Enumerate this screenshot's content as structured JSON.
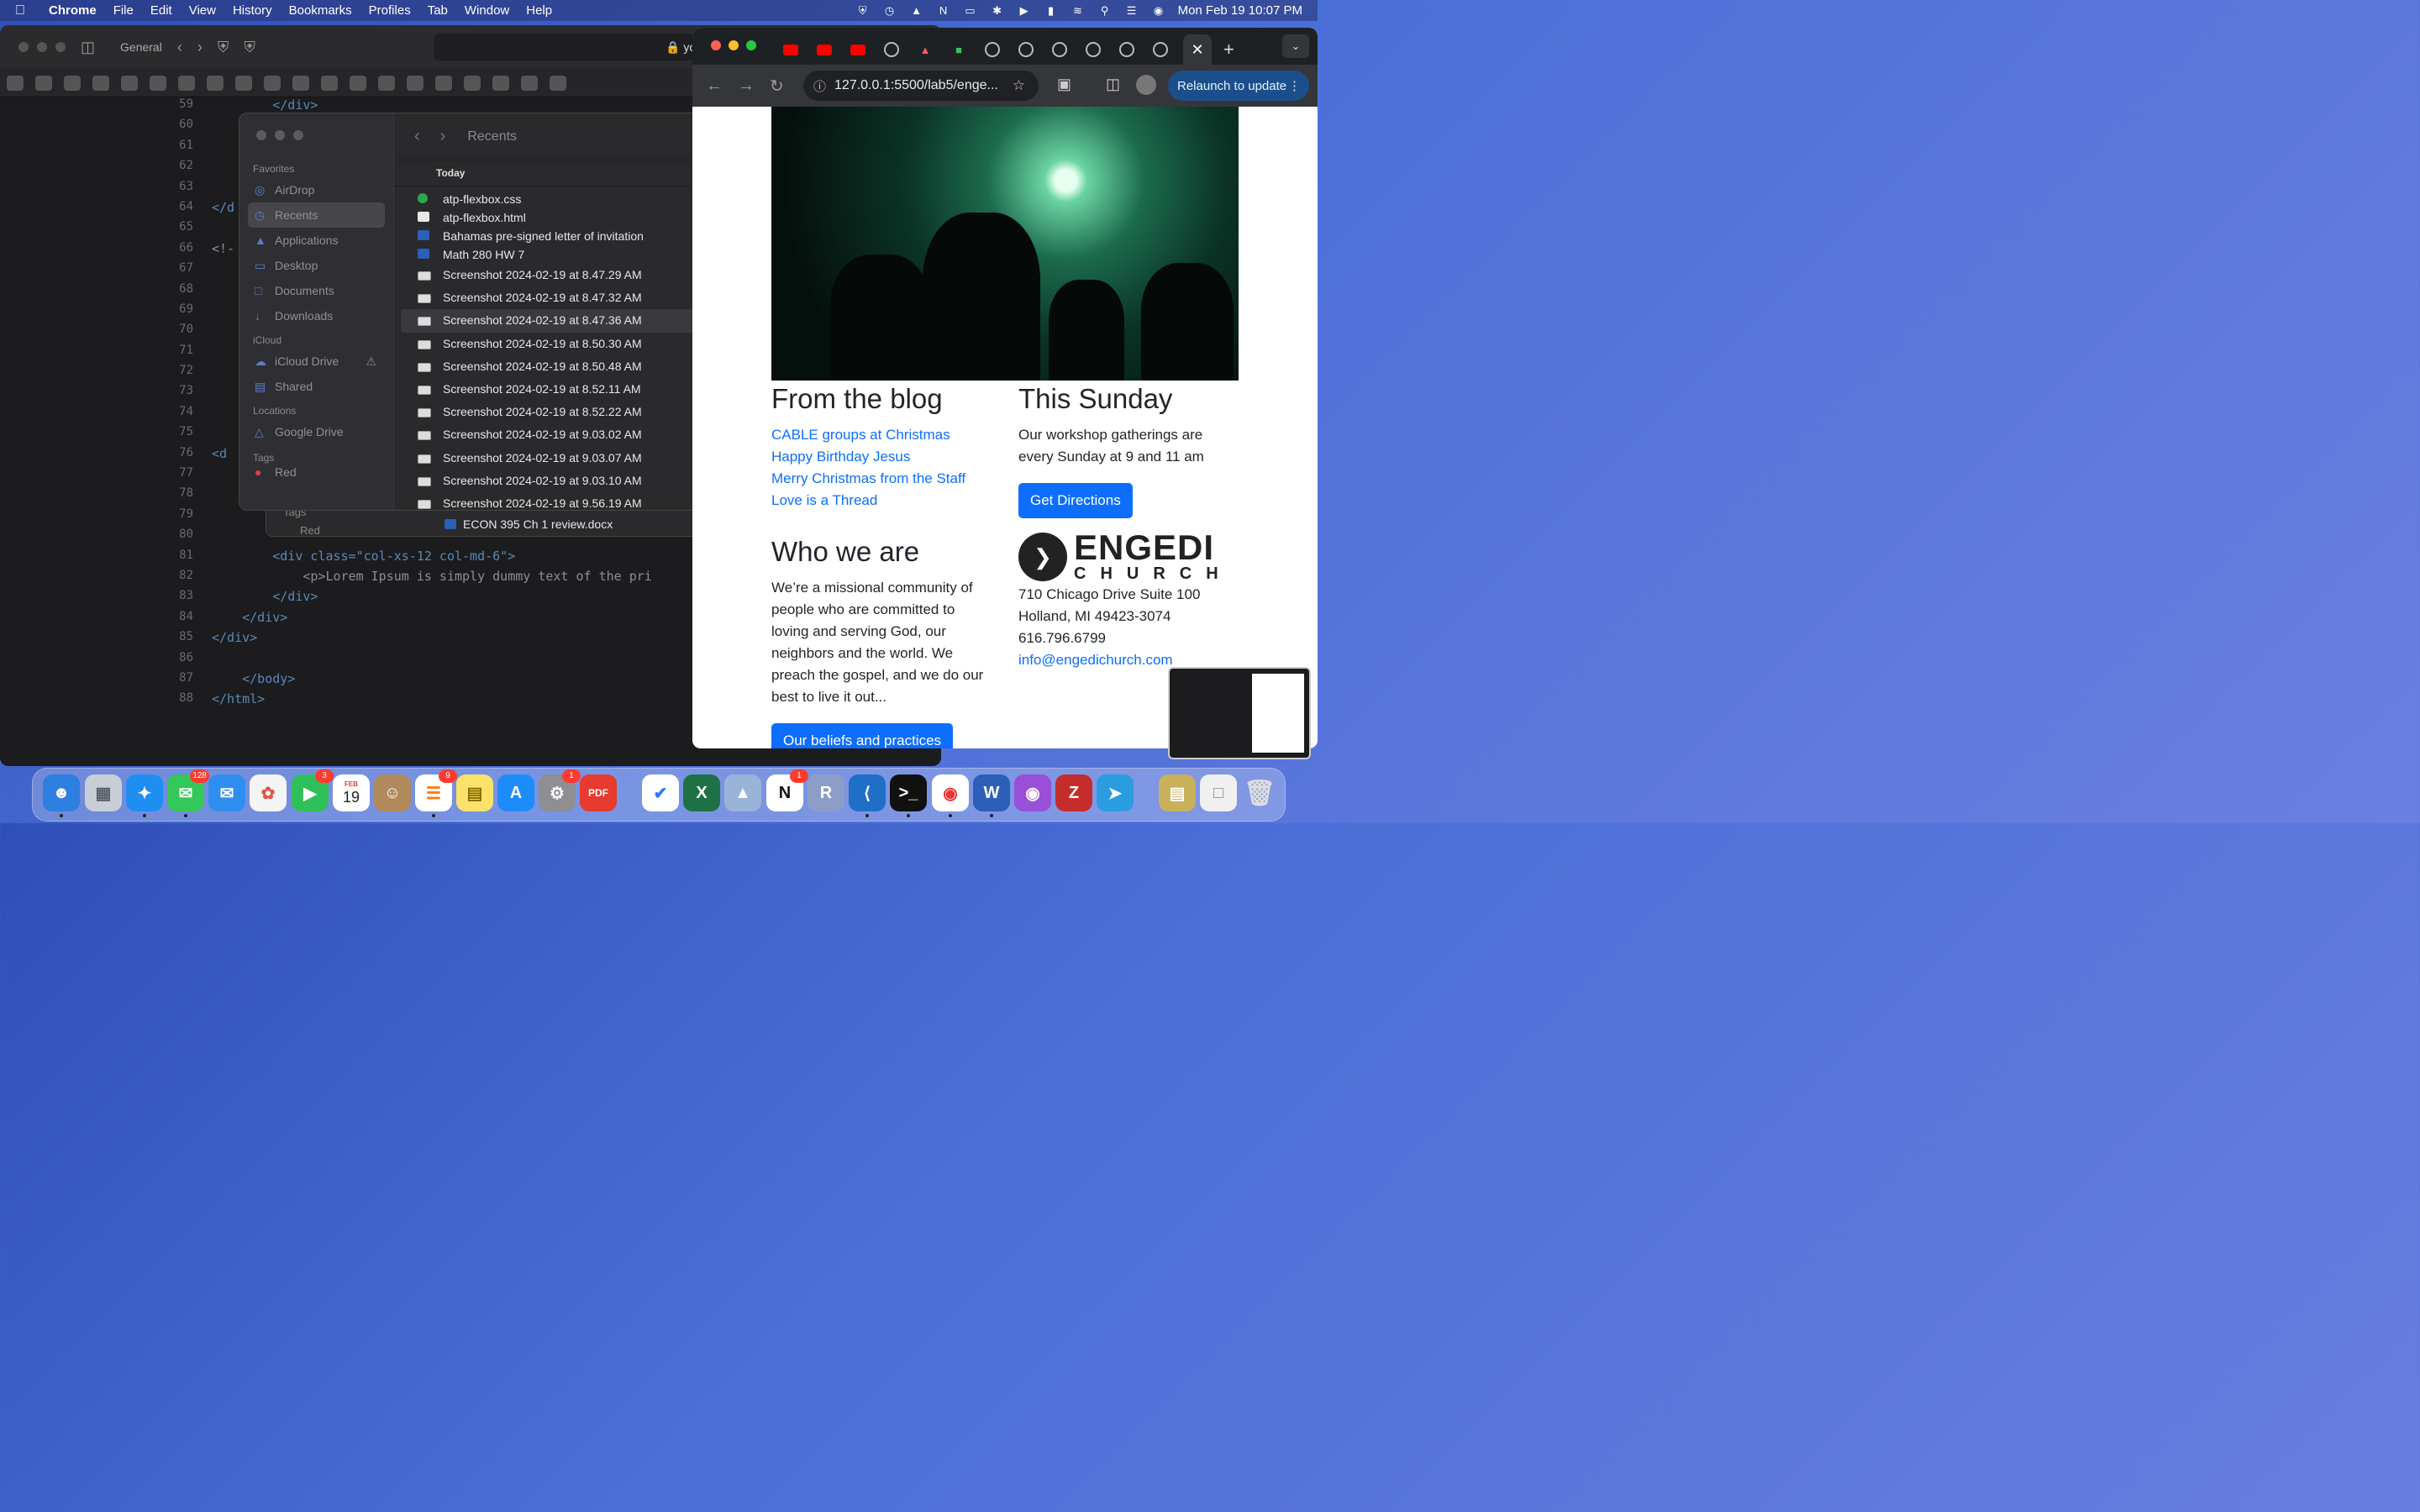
{
  "menubar": {
    "app": "Chrome",
    "items": [
      "File",
      "Edit",
      "View",
      "History",
      "Bookmarks",
      "Profiles",
      "Tab",
      "Window",
      "Help"
    ],
    "datetime": "Mon Feb 19  10:07 PM"
  },
  "editor": {
    "profile": "General",
    "url_fragment": "you",
    "line_numbers": [
      "59",
      "60",
      "61",
      "62",
      "63",
      "64",
      "65",
      "66",
      "67",
      "68",
      "69",
      "70",
      "71",
      "72",
      "73",
      "74",
      "75",
      "76",
      "77",
      "78",
      "79",
      "80",
      "81",
      "82",
      "83",
      "84",
      "85",
      "86",
      "87",
      "88"
    ],
    "code": {
      "l59": "        </div>",
      "l64": "</d",
      "l66": "<!-",
      "l76": "<d",
      "l81": "        <div class=\"col-xs-12 col-md-6\">",
      "l82": "            <p>Lorem Ipsum is simply dummy text of the pri",
      "l83": "        </div>",
      "l84": "    </div>",
      "l85": "</div>",
      "l87": "    </body>",
      "l88": "</html>"
    }
  },
  "finder": {
    "title": "Recents",
    "sections": {
      "favorites": "Favorites",
      "icloud": "iCloud",
      "locations": "Locations",
      "tags": "Tags"
    },
    "favorites": [
      "AirDrop",
      "Recents",
      "Applications",
      "Desktop",
      "Documents",
      "Downloads"
    ],
    "icloud_items": [
      "iCloud Drive",
      "Shared"
    ],
    "locations_items": [
      "Google Drive"
    ],
    "tag_red": "Red",
    "group": "Today",
    "files": [
      "atp-flexbox.css",
      "atp-flexbox.html",
      "Bahamas pre-signed letter of invitation",
      "Math 280 HW 7",
      "Screenshot 2024-02-19 at 8.47.29 AM",
      "Screenshot 2024-02-19 at 8.47.32 AM",
      "Screenshot 2024-02-19 at 8.47.36 AM",
      "Screenshot 2024-02-19 at 8.50.30 AM",
      "Screenshot 2024-02-19 at 8.50.48 AM",
      "Screenshot 2024-02-19 at 8.52.11 AM",
      "Screenshot 2024-02-19 at 8.52.22 AM",
      "Screenshot 2024-02-19 at 9.03.02 AM",
      "Screenshot 2024-02-19 at 9.03.07 AM",
      "Screenshot 2024-02-19 at 9.03.10 AM",
      "Screenshot 2024-02-19 at 9.56.19 AM"
    ],
    "behind_tags": "Tags",
    "behind_red": "Red",
    "behind_file": "ECON 395 Ch 1 review.docx"
  },
  "chrome": {
    "url": "127.0.0.1:5500/lab5/enge...",
    "relaunch": "Relaunch to update",
    "page": {
      "blog_heading": "From the blog",
      "blog_links": [
        "CABLE groups at Christmas",
        "Happy Birthday Jesus",
        "Merry Christmas from the Staff",
        "Love is a Thread"
      ],
      "who_heading": "Who we are",
      "who_text": "We’re a missional community of people who are committed to loving and serving God, our neighbors and the world. We preach the gospel, and we do our best to live it out...",
      "beliefs_button": "Our beliefs and practices",
      "sunday_heading": "This Sunday",
      "sunday_text": "Our workshop gatherings are every Sunday at 9 and 11 am",
      "directions_button": "Get Directions",
      "logo_top": "ENGEDI",
      "logo_bottom": "CHURCH",
      "address1": "710 Chicago Drive Suite 100",
      "address2": "Holland, MI 49423-3074",
      "phone": "616.796.6799",
      "email": "info@engedichurch.com"
    }
  },
  "dock": {
    "badges": {
      "messages": "128",
      "facetime": "3",
      "reminders": "9",
      "settings": "1",
      "notion": "1"
    },
    "calendar_month": "FEB",
    "calendar_day": "19",
    "notion_letter": "N",
    "r_letter": "R"
  }
}
